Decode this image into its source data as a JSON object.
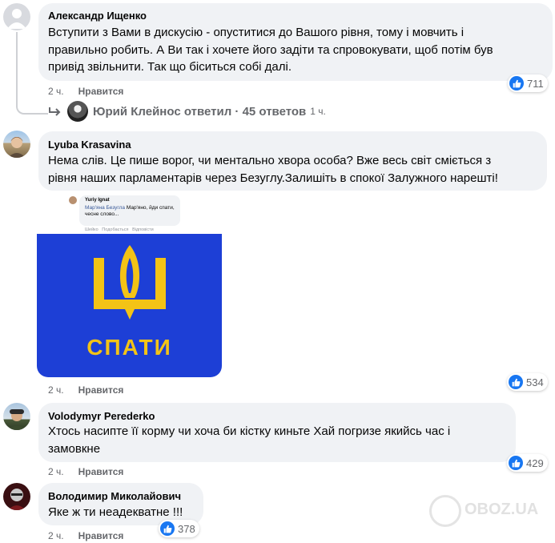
{
  "comments": [
    {
      "author": "Александр Ищенко",
      "text": "Вступити з Вами в дискусію - опуститися до Вашого рівня, тому і мовчить і\nправильно робить. А Ви так і хочете його задіти та спровокувати, щоб потім був\nпривід звільнити. Так що біситься собі далі.",
      "time": "2 ч.",
      "like_label": "Нравится",
      "reactions": "711",
      "reply": {
        "name": "Юрий Клейнос",
        "text": "ответил · 45 ответов",
        "time": "1 ч."
      }
    },
    {
      "author": "Lyuba Krasavina",
      "text": "Нема слів. Це пише ворог, чи ментально хвора особа? Вже весь світ сміється з\nрівня наших парламентарів через Безуглу.Залишіть в спокої Залужного нарешті!",
      "time": "2 ч.",
      "like_label": "Нравится",
      "reactions": "534",
      "image": {
        "inner_author": "Yuriy Ignat",
        "inner_mention": "Мар'яна Безугла",
        "inner_text": "Мар'яно, йди спати, чесне слово...",
        "inner_actions": [
          "Шейко",
          "Подобається",
          "Відповісти"
        ],
        "poster_text": "СПАТИ",
        "colors": {
          "blue": "#1d3fd6",
          "yellow": "#f3c316"
        }
      }
    },
    {
      "author": "Volodymyr Perederko",
      "text": "Хтось насипте її корму чи хоча би кістку киньте Хай погризе якийсь час і\nзамовкне",
      "time": "2 ч.",
      "like_label": "Нравится",
      "reactions": "429"
    },
    {
      "author": "Володимир Миколайович",
      "text": "Яке ж ти неадекватне !!!",
      "time": "2 ч.",
      "like_label": "Нравится",
      "reactions": "378"
    }
  ],
  "watermark": "OBOZ.UA",
  "colors": {
    "facebook_blue": "#1877f2",
    "bubble": "#f0f2f5",
    "meta": "#65676b"
  }
}
